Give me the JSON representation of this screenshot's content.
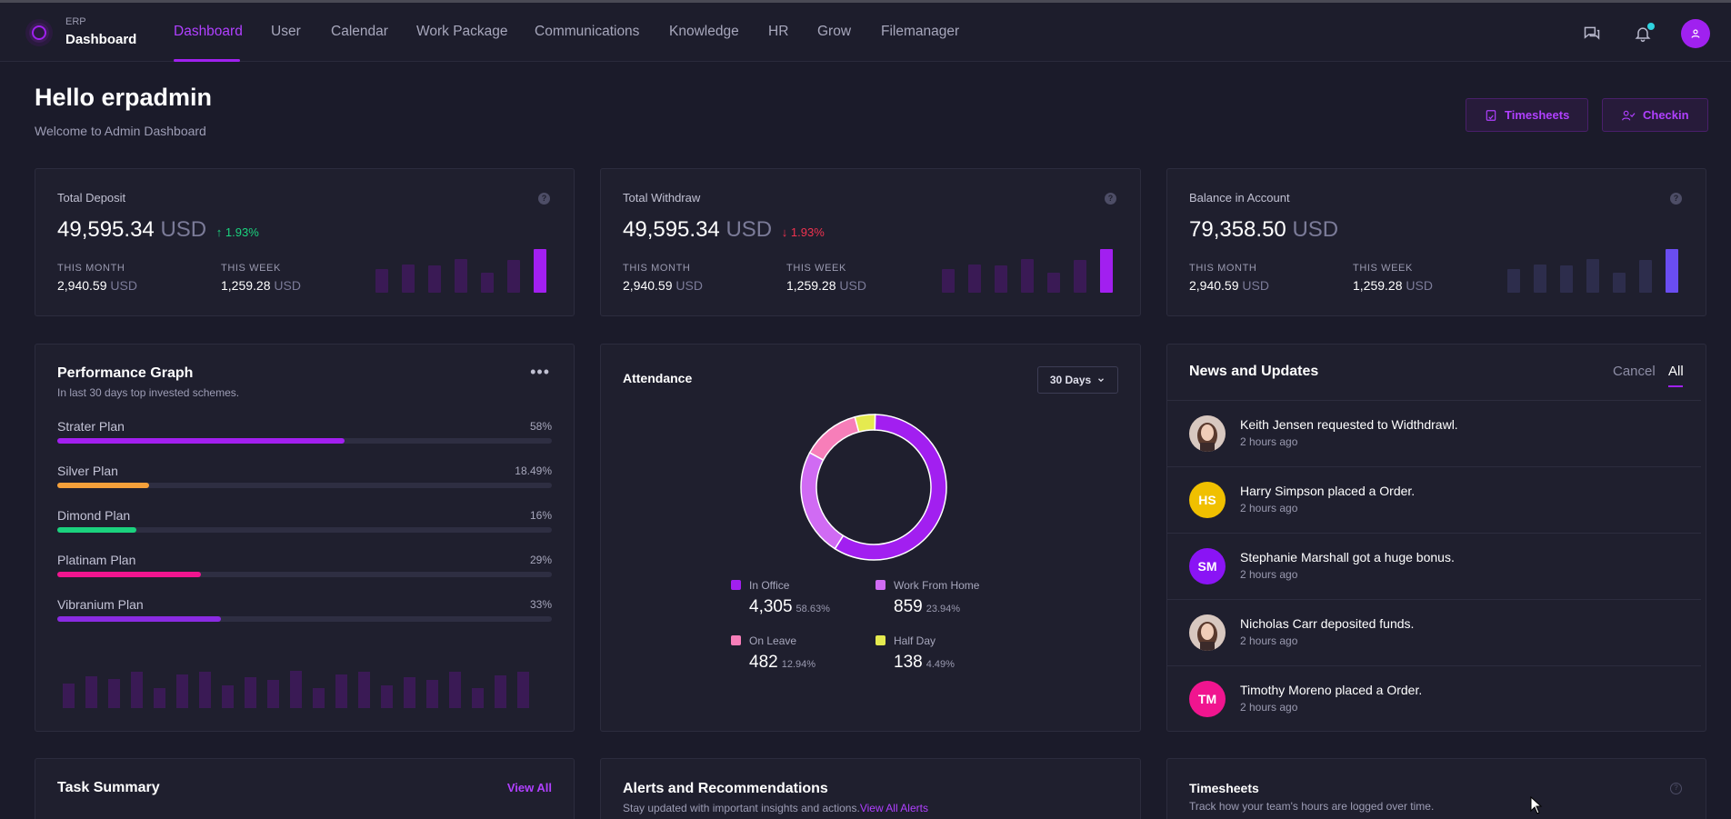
{
  "brand": {
    "small": "ERP",
    "title": "Dashboard"
  },
  "nav": {
    "items": [
      {
        "label": "Dashboard"
      },
      {
        "label": "User"
      },
      {
        "label": "Calendar"
      },
      {
        "label": "Work Package"
      },
      {
        "label": "Communications"
      },
      {
        "label": "Knowledge"
      },
      {
        "label": "HR"
      },
      {
        "label": "Grow"
      },
      {
        "label": "Filemanager"
      }
    ],
    "active": "Dashboard",
    "icons": [
      "chat-icon",
      "bell-icon",
      "user-icon"
    ]
  },
  "header": {
    "greeting": "Hello erpadmin",
    "subtitle": "Welcome to Admin Dashboard",
    "timesheets_button": "Timesheets",
    "checkin_button": "Checkin"
  },
  "stats": [
    {
      "title": "Total Deposit",
      "value": "49,595.34",
      "unit": "USD",
      "change": "↑ 1.93%",
      "change_color": "#1bd27e",
      "month_label": "THIS MONTH",
      "month_value": "2,940.59",
      "week_label": "THIS WEEK",
      "week_value": "1,259.28",
      "bars": [
        0.55,
        0.65,
        0.62,
        0.78,
        0.45,
        0.76,
        1.0
      ],
      "bar_color": "#3a1a55",
      "bar_highlight": "#a21ff0"
    },
    {
      "title": "Total Withdraw",
      "value": "49,595.34",
      "unit": "USD",
      "change": "↓ 1.93%",
      "change_color": "#f0324f",
      "month_label": "THIS MONTH",
      "month_value": "2,940.59",
      "week_label": "THIS WEEK",
      "week_value": "1,259.28",
      "bars": [
        0.55,
        0.65,
        0.62,
        0.78,
        0.45,
        0.76,
        1.0
      ],
      "bar_color": "#3a1a55",
      "bar_highlight": "#a21ff0"
    },
    {
      "title": "Balance in Account",
      "value": "79,358.50",
      "unit": "USD",
      "change": "",
      "change_color": "#ffffff",
      "month_label": "THIS MONTH",
      "month_value": "2,940.59",
      "week_label": "THIS WEEK",
      "week_value": "1,259.28",
      "bars": [
        0.55,
        0.65,
        0.62,
        0.78,
        0.45,
        0.76,
        1.0
      ],
      "bar_color": "#2d2d4c",
      "bar_highlight": "#6a4df0"
    }
  ],
  "stat_unit": "USD",
  "performance": {
    "title": "Performance Graph",
    "subtitle": "In last 30 days top invested schemes.",
    "plans": [
      {
        "name": "Strater Plan",
        "pct_label": "58%",
        "pct": 58,
        "color": "#a21ff0"
      },
      {
        "name": "Silver Plan",
        "pct_label": "18.49%",
        "pct": 18.49,
        "color": "#f5a03a"
      },
      {
        "name": "Dimond Plan",
        "pct_label": "16%",
        "pct": 16,
        "color": "#1bd27e"
      },
      {
        "name": "Platinam Plan",
        "pct_label": "29%",
        "pct": 29,
        "color": "#f0158f"
      },
      {
        "name": "Vibranium Plan",
        "pct_label": "33%",
        "pct": 33,
        "color": "#8a2be2"
      }
    ],
    "bars": [
      0.55,
      0.7,
      0.65,
      0.8,
      0.45,
      0.75,
      0.8,
      0.5,
      0.68,
      0.62,
      0.82,
      0.45,
      0.75,
      0.8,
      0.5,
      0.68,
      0.62,
      0.8,
      0.45,
      0.72,
      0.8
    ]
  },
  "attendance": {
    "title": "Attendance",
    "range": "30 Days",
    "segments": [
      {
        "label": "In Office",
        "value": "4,305",
        "pct_label": "58.63%",
        "pct": 58.63,
        "color": "#a21ff0"
      },
      {
        "label": "Work From Home",
        "value": "859",
        "pct_label": "23.94%",
        "pct": 23.94,
        "color": "#d06bf3"
      },
      {
        "label": "On Leave",
        "value": "482",
        "pct_label": "12.94%",
        "pct": 12.94,
        "color": "#f77eb9"
      },
      {
        "label": "Half Day",
        "value": "138",
        "pct_label": "4.49%",
        "pct": 4.49,
        "color": "#e5ea4f"
      }
    ]
  },
  "news": {
    "title": "News and Updates",
    "tab_cancel": "Cancel",
    "tab_all": "All",
    "items": [
      {
        "text": "Keith Jensen requested to Widthdrawl.",
        "time": "2 hours ago",
        "initials": "",
        "color": "#6d4b4b",
        "photo": true
      },
      {
        "text": "Harry Simpson placed a Order.",
        "time": "2 hours ago",
        "initials": "HS",
        "color": "#f0c000",
        "photo": false
      },
      {
        "text": "Stephanie Marshall got a huge bonus.",
        "time": "2 hours ago",
        "initials": "SM",
        "color": "#8a14f5",
        "photo": false
      },
      {
        "text": "Nicholas Carr deposited funds.",
        "time": "2 hours ago",
        "initials": "",
        "color": "#6d4b4b",
        "photo": true
      },
      {
        "text": "Timothy Moreno placed a Order.",
        "time": "2 hours ago",
        "initials": "TM",
        "color": "#f0158f",
        "photo": false
      }
    ]
  },
  "bottom": {
    "task_title": "Task Summary",
    "task_link": "View All",
    "alerts_title": "Alerts and Recommendations",
    "alerts_sub": "Stay updated with important insights and actions.",
    "alerts_link": "View All Alerts",
    "timesheets_title": "Timesheets",
    "timesheets_sub": "Track how your team's hours are logged over time."
  }
}
